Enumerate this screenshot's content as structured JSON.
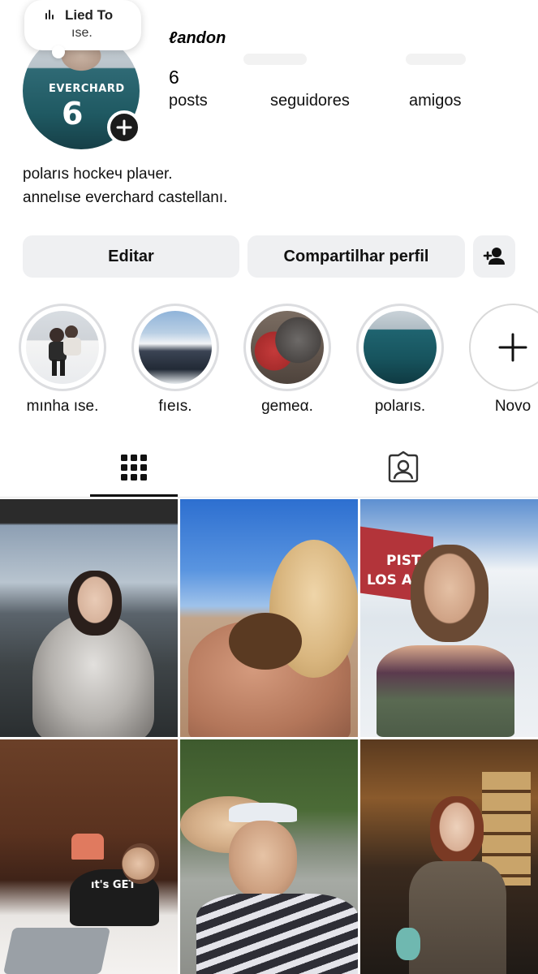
{
  "profile": {
    "username": "ℓandon",
    "avatar_jersey_name": "EVERCHARD",
    "avatar_jersey_number": "6",
    "note_title": "Lied To",
    "note_subtitle": "ıse.",
    "posts_count": "6",
    "posts_label": "posts",
    "followers_label": "seguidores",
    "friends_label": "amigos",
    "bio_line1": "polarıs hockeч plaчer.",
    "bio_line2": "annelıse everchard castellanı."
  },
  "actions": {
    "edit_label": "Editar",
    "share_label": "Compartilhar perfil",
    "add_friend_icon": "add-person-icon"
  },
  "highlights": [
    {
      "label": "mınha ıse."
    },
    {
      "label": "fıeıs."
    },
    {
      "label": "gemeα."
    },
    {
      "label": "polarıs."
    },
    {
      "label": "Novo"
    }
  ],
  "tabs": {
    "grid_icon": "grid-icon",
    "tagged_icon": "tagged-person-icon",
    "active": "grid"
  },
  "posts": {
    "tile3_sign_line1": "PISTA",
    "tile3_sign_line2": "LOS ASNO",
    "tile4_shirt_text": "ıt's GET"
  },
  "colors": {
    "button_bg": "#eff0f2",
    "text": "#111111",
    "accent_jersey": "#1f5962"
  }
}
